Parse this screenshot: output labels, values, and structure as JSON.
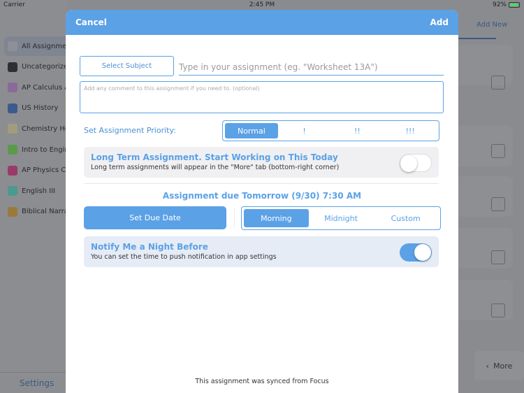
{
  "status_bar": {
    "carrier": "Carrier",
    "time": "2:45 PM",
    "battery": "92%"
  },
  "sidebar": {
    "items": [
      {
        "label": "All Assignments",
        "color": "#8e9098"
      },
      {
        "label": "Uncategorized",
        "color": "#2e2f33"
      },
      {
        "label": "AP Calculus AB",
        "color": "#8a6a9a"
      },
      {
        "label": "US History",
        "color": "#3c5a8c"
      },
      {
        "label": "Chemistry Honors",
        "color": "#a39c7c"
      },
      {
        "label": "Intro to Engineering",
        "color": "#5a9a4a"
      },
      {
        "label": "AP Physics C: Mechanics",
        "color": "#9a3a6a"
      },
      {
        "label": "English III",
        "color": "#4a9a92"
      },
      {
        "label": "Biblical Narrative",
        "color": "#9a7a3a"
      }
    ],
    "settings_label": "Settings"
  },
  "background": {
    "add_new_label": "Add New",
    "more_label": "More"
  },
  "modal": {
    "cancel_label": "Cancel",
    "add_label": "Add",
    "select_subject_label": "Select Subject",
    "assignment_placeholder": "Type in your assignment (eg. \"Worksheet 13A\")",
    "comment_placeholder": "Add any comment to this assignment if you need to. (optional)",
    "priority_label": "Set Assignment Priority:",
    "priority_options": [
      "Normal",
      "!",
      "!!",
      "!!!"
    ],
    "priority_selected": "Normal",
    "long_term": {
      "title": "Long Term Assignment. Start Working on This Today",
      "subtitle": "Long term assignments will appear in the \"More\" tab (bottom-right corner)",
      "enabled": false
    },
    "due_text": "Assignment due Tomorrow (9/30) 7:30 AM",
    "set_due_date_label": "Set Due Date",
    "time_options": [
      "Morning",
      "Midnight",
      "Custom"
    ],
    "time_selected": "Morning",
    "notify": {
      "title": "Notify Me a Night Before",
      "subtitle": "You can set the time to push notification in app settings",
      "enabled": true
    },
    "synced_text": "This assignment was synced from Focus"
  },
  "colors": {
    "accent": "#5ba1e6"
  }
}
